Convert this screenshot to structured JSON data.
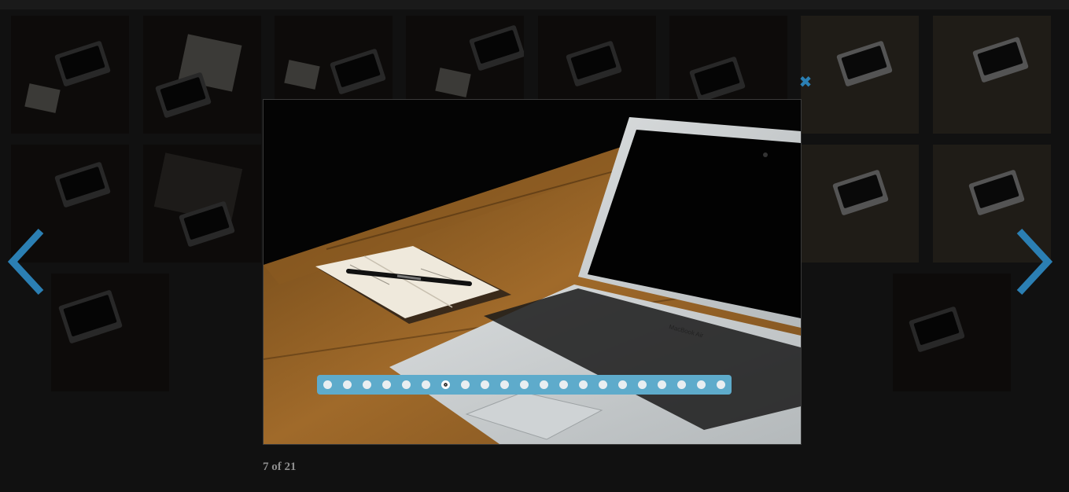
{
  "lightbox": {
    "counter_text": "7 of 21",
    "current_index": 7,
    "total": 21,
    "laptop_brand_text": "MacBook Air"
  },
  "controls": {
    "close_icon": "close-icon",
    "prev_icon": "chevron-left-icon",
    "next_icon": "chevron-right-icon",
    "close_glyph": "✖"
  },
  "colors": {
    "accent": "#2b7fb3",
    "dots_bar": "#5eabcb",
    "background": "#111111",
    "counter_text": "#8e8e8e"
  },
  "gallery": {
    "thumbnail_count": 21
  }
}
